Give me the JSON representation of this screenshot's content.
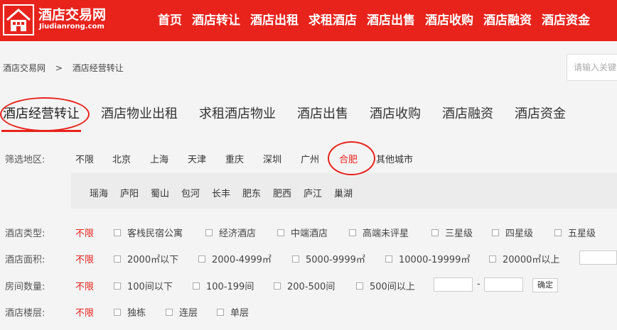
{
  "logo": {
    "name": "酒店交易网",
    "domain": "Jiudianrong.com"
  },
  "nav": [
    "首页",
    "酒店转让",
    "酒店出租",
    "求租酒店",
    "酒店出售",
    "酒店收购",
    "酒店融资",
    "酒店资金"
  ],
  "breadcrumb": {
    "home": "酒店交易网",
    "sep": ">",
    "current": "酒店经营转让"
  },
  "search": {
    "placeholder": "请输入关键词"
  },
  "categories": [
    "酒店经营转让",
    "酒店物业出租",
    "求租酒店物业",
    "酒店出售",
    "酒店收购",
    "酒店融资",
    "酒店资金"
  ],
  "filters": {
    "region": {
      "label": "筛选地区:",
      "items": [
        "不限",
        "北京",
        "上海",
        "天津",
        "重庆",
        "深圳",
        "广州",
        "合肥",
        "其他城市"
      ],
      "sub_items": [
        "瑶海",
        "庐阳",
        "蜀山",
        "包河",
        "长丰",
        "肥东",
        "肥西",
        "庐江",
        "巢湖"
      ]
    },
    "type": {
      "label": "酒店类型:",
      "all": "不限",
      "options": [
        "客栈民宿公寓",
        "经济酒店",
        "中端酒店",
        "高端未评星",
        "三星级",
        "四星级",
        "五星级"
      ]
    },
    "area": {
      "label": "酒店面积:",
      "all": "不限",
      "options": [
        "2000㎡以下",
        "2000-4999㎡",
        "5000-9999㎡",
        "10000-19999㎡",
        "20000㎡以上"
      ]
    },
    "rooms": {
      "label": "房间数量:",
      "all": "不限",
      "options": [
        "100间以下",
        "100-199间",
        "200-500间",
        "500间以上"
      ],
      "dash": "-",
      "confirm": "确定"
    },
    "floors": {
      "label": "酒店楼层:",
      "all": "不限",
      "options": [
        "独栋",
        "连层",
        "单层"
      ]
    }
  },
  "colors": {
    "brand": "#e8231c"
  },
  "icons": {
    "logo": "hotel-building-icon"
  }
}
